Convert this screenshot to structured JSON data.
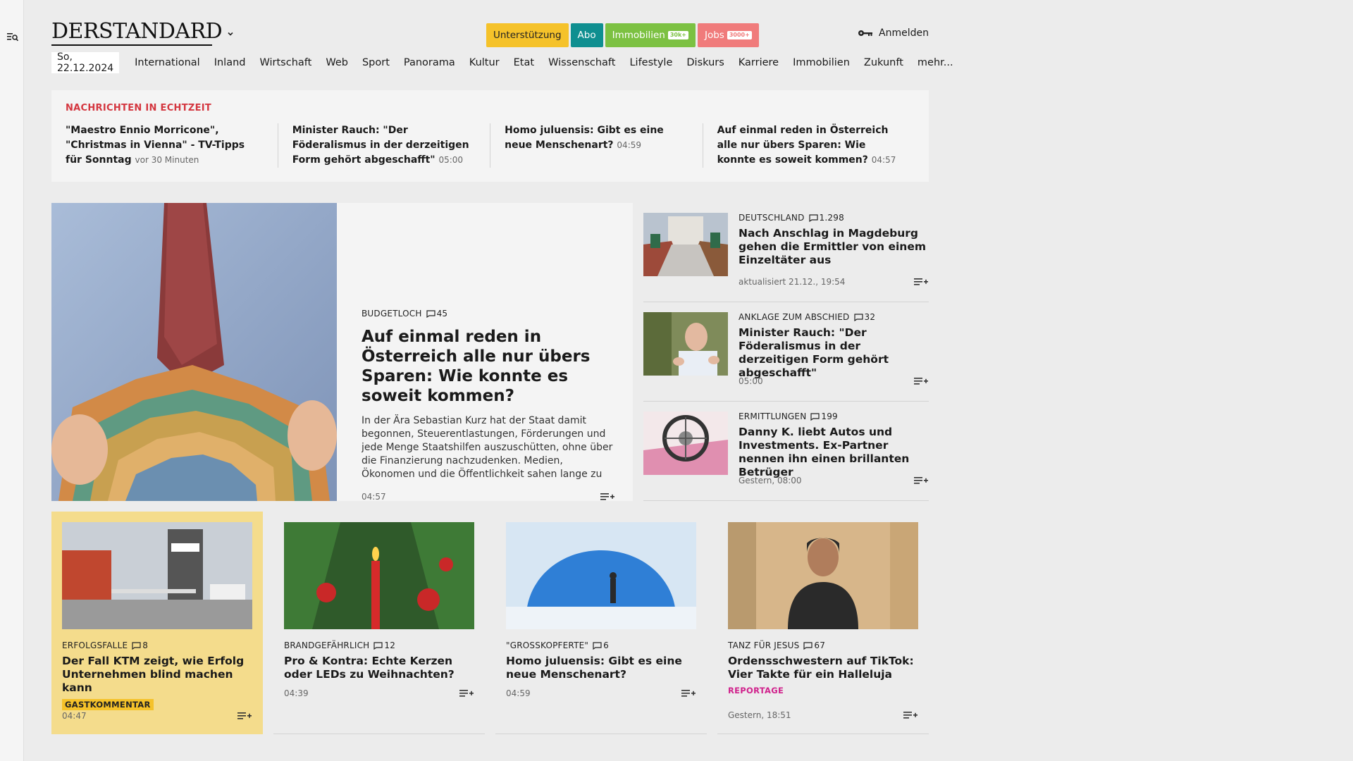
{
  "brand": {
    "logo": "DERSTANDARD"
  },
  "header": {
    "pills": [
      {
        "label": "Unterstützung",
        "badge": ""
      },
      {
        "label": "Abo",
        "badge": ""
      },
      {
        "label": "Immobilien",
        "badge": "30k+"
      },
      {
        "label": "Jobs",
        "badge": "3000+"
      }
    ],
    "login_label": "Anmelden"
  },
  "nav": {
    "date": "So, 22.12.2024",
    "items": [
      "International",
      "Inland",
      "Wirtschaft",
      "Web",
      "Sport",
      "Panorama",
      "Kultur",
      "Etat",
      "Wissenschaft",
      "Lifestyle",
      "Diskurs",
      "Karriere",
      "Immobilien",
      "Zukunft",
      "mehr..."
    ]
  },
  "ticker": {
    "title": "NACHRICHTEN IN ECHTZEIT",
    "items": [
      {
        "text": "\"Maestro Ennio Morricone\", \"Christmas in Vienna\" - TV-Tipps für Sonntag",
        "time": "vor 30 Minuten"
      },
      {
        "text": "Minister Rauch: \"Der Föderalismus in der derzeitigen Form gehört abgeschafft\"",
        "time": "05:00"
      },
      {
        "text": "Homo juluensis: Gibt es eine neue Menschenart?",
        "time": "04:59"
      },
      {
        "text": "Auf einmal reden in Österreich alle nur übers Sparen: Wie konnte es soweit kommen?",
        "time": "04:57"
      }
    ]
  },
  "hero": {
    "kicker": "BUDGETLOCH",
    "comments": "45",
    "title": "Auf einmal reden in Österreich alle nur übers Sparen: Wie konnte es soweit kommen?",
    "lead": "In der Ära Sebastian Kurz hat der Staat damit begonnen, Steuerentlastungen, Förderungen und jede Menge Staatshilfen auszuschütten, ohne über die Finanzierung nachzudenken. Medien, Ökonomen und die Öffentlichkeit sahen lange zu",
    "time": "04:57"
  },
  "side": [
    {
      "kicker": "DEUTSCHLAND",
      "comments": "1.298",
      "title": "Nach Anschlag in Magdeburg gehen die Ermittler von einem Einzeltäter aus",
      "time": "aktualisiert 21.12., 19:54"
    },
    {
      "kicker": "ANKLAGE ZUM ABSCHIED",
      "comments": "32",
      "title": "Minister Rauch: \"Der Föderalismus in der derzeitigen Form gehört abgeschafft\"",
      "time": "05:00"
    },
    {
      "kicker": "ERMITTLUNGEN",
      "comments": "199",
      "title": "Danny K. liebt Autos und Investments. Ex-Partner nennen ihn einen brillanten Betrüger",
      "time": "Gestern, 08:00"
    }
  ],
  "cards": [
    {
      "kicker": "ERFOLGSFALLE",
      "comments": "8",
      "title": "Der Fall KTM zeigt, wie Erfolg Unternehmen blind machen kann",
      "tag": "GASTKOMMENTAR",
      "time": "04:47"
    },
    {
      "kicker": "BRANDGEFÄHRLICH",
      "comments": "12",
      "title": "Pro & Kontra: Echte Kerzen oder LEDs zu Weihnachten?",
      "tag": "",
      "time": "04:39"
    },
    {
      "kicker": "\"GROSSKOPFERTE\"",
      "comments": "6",
      "title": "Homo juluensis: Gibt es eine neue Menschenart?",
      "tag": "",
      "time": "04:59"
    },
    {
      "kicker": "TANZ FÜR JESUS",
      "comments": "67",
      "title": "Ordensschwestern auf TikTok: Vier Takte für ein Halleluja",
      "tag": "REPORTAGE",
      "time": "Gestern, 18:51"
    }
  ],
  "colors": {
    "accent_red": "#d4363f",
    "reportage": "#d0228c",
    "highlight": "#f4dc8c"
  }
}
